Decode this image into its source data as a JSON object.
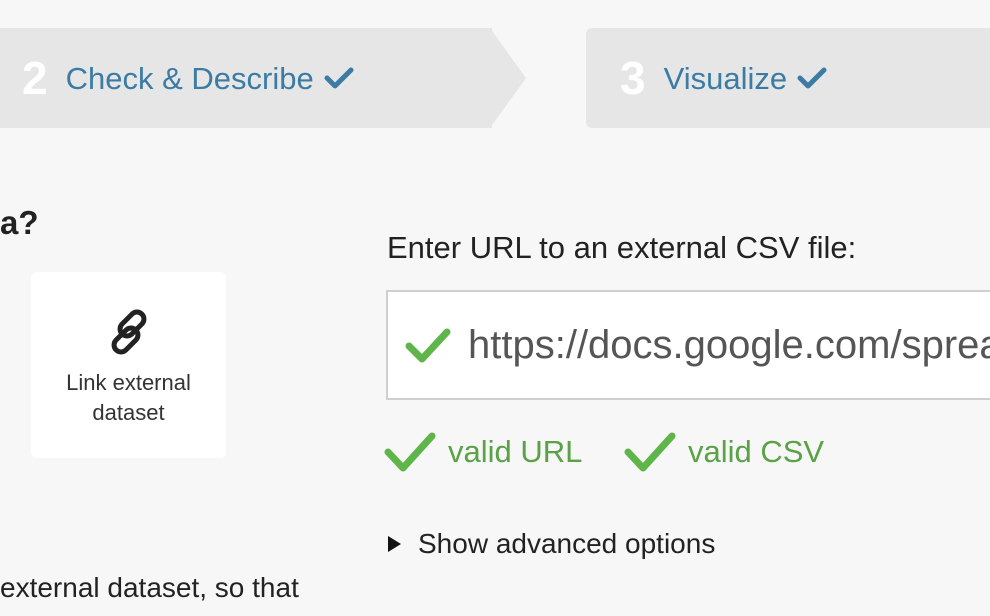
{
  "steps": [
    {
      "number": "2",
      "label": "Check & Describe",
      "status_icon": "check-icon"
    },
    {
      "number": "3",
      "label": "Visualize",
      "status_icon": "check-icon"
    }
  ],
  "question_fragment": "a?",
  "link_card": {
    "icon": "link-icon",
    "label": "Link external dataset"
  },
  "url_section": {
    "prompt": "Enter URL to an external CSV file:",
    "value": "https://docs.google.com/spreadsheets/d/",
    "status_icon": "check-icon"
  },
  "validation": [
    {
      "label": "valid URL",
      "icon": "check-icon"
    },
    {
      "label": "valid CSV",
      "icon": "check-icon"
    }
  ],
  "advanced_toggle": {
    "label": "Show advanced options",
    "icon": "triangle-right-icon"
  },
  "description_fragment": "external dataset, so that",
  "colors": {
    "step_bg": "#e6e6e6",
    "step_label": "#3b7ba4",
    "valid_green": "#5aa245",
    "url_check_green": "#5fb44a"
  }
}
